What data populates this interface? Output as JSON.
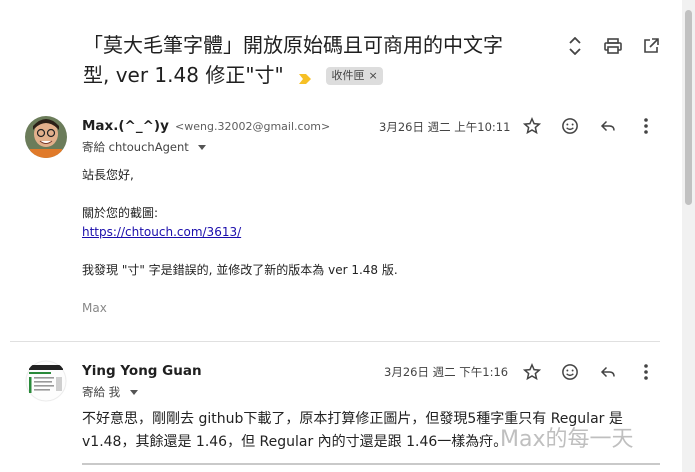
{
  "thread": {
    "subject_line1": "「莫大毛筆字體」開放原始碼且可商用的中文字",
    "subject_line2": "型, ver 1.48 修正\"寸\"",
    "label": "收件匣",
    "label_remove": "×"
  },
  "icons": {
    "expand": "unfold-icon",
    "print": "print-icon",
    "open_new_window": "open-in-new-icon",
    "important": "important-marker-icon",
    "star": "star-icon",
    "react": "emoji-icon",
    "reply": "reply-icon",
    "more": "more-vert-icon"
  },
  "messages": [
    {
      "sender_name": "Max.(^_^)y",
      "sender_email": "<weng.32002@gmail.com>",
      "to": "寄給 chtouchAgent",
      "time": "3月26日 週二 上午10:11",
      "body": {
        "greeting": "站長您好,",
        "line2": "關於您的截圖:",
        "link": "https://chtouch.com/3613/",
        "line4": "我發現 \"寸\" 字是錯誤的, 並修改了新的版本為 ver 1.48 版.",
        "signature": "Max"
      }
    },
    {
      "sender_name": "Ying Yong Guan",
      "to": "寄給 我",
      "time": "3月26日 週二 下午1:16",
      "body": "不好意思，剛剛去 github下載了，原本打算修正圖片，但發現5種字重只有 Regular 是 v1.48，其餘還是 1.46，但 Regular 內的寸還是跟 1.46一樣為疛。"
    }
  ],
  "watermark": "Max的每一天",
  "colors": {
    "important": "#f6c026",
    "link": "#1a0dab",
    "chip_bg": "#dddddd"
  }
}
